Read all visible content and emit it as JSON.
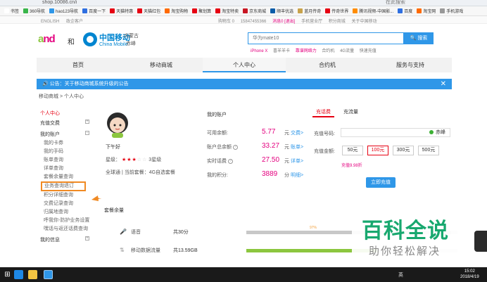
{
  "browser": {
    "url": "shop.10086.cn/i",
    "search_hint": "在此搜索",
    "bookmarks": [
      {
        "label": "书签",
        "color": "#ffffff"
      },
      {
        "label": "360导航",
        "color": "#39b54a"
      },
      {
        "label": "hao123导航",
        "color": "#2f97e8"
      },
      {
        "label": "百度一下",
        "color": "#2f6fe0"
      },
      {
        "label": "天猫特惠",
        "color": "#e60012"
      },
      {
        "label": "天猫红包",
        "color": "#e60012"
      },
      {
        "label": "淘宝购物",
        "color": "#ff6a00"
      },
      {
        "label": "聚划算",
        "color": "#e60012"
      },
      {
        "label": "淘宝特卖",
        "color": "#e60012"
      },
      {
        "label": "京东商城",
        "color": "#c81623"
      },
      {
        "label": "顺丰优选",
        "color": "#0a5ca8"
      },
      {
        "label": "蓝月传奇",
        "color": "#c8a24a"
      },
      {
        "label": "传奇世界",
        "color": "#e60012"
      },
      {
        "label": "腾讯视频-中国影...",
        "color": "#ff8c00"
      },
      {
        "label": "百度",
        "color": "#2f6fe0"
      },
      {
        "label": "淘宝网",
        "color": "#ff6a00"
      },
      {
        "label": "手机游戏",
        "color": "#999999"
      }
    ]
  },
  "topstrip": {
    "left": [
      "ENGLISH",
      "政企客户"
    ],
    "right": [
      "购物车 0",
      "15847455366",
      "消息0 [退出]",
      "手机营业厅",
      "积分商城",
      "关于中国移动"
    ]
  },
  "header": {
    "logo_and": "and",
    "logo_he": "和",
    "brand_cn": "中国移动",
    "brand_en": "China Mobile",
    "region_province": "内蒙古",
    "region_city": "赤峰",
    "search_placeholder": "华为mate10",
    "search_button": "搜索",
    "hotwords": [
      "iPhone X",
      "喜羊羊卡",
      "靠谱网络力",
      "合约机",
      "4G流量",
      "快速充值"
    ]
  },
  "nav": {
    "items": [
      "首页",
      "移动商城",
      "个人中心",
      "合约机",
      "服务与支持"
    ],
    "active_index": 2
  },
  "notice": {
    "text": "公告：关于移动商城系统升级的公告",
    "close": "✕"
  },
  "breadcrumb": "移动商城 > 个人中心",
  "sidebar": {
    "head": "个人中心",
    "sections": [
      {
        "title": "充值交费",
        "items": []
      },
      {
        "title": "我的账户",
        "items": [
          "我的卡券",
          "我的手码",
          "账单查询",
          "详单查询",
          "套餐余量查询",
          "业务查询退订",
          "积分详细查询",
          "交费记录查询",
          "归属地查询",
          "呼我你-防护业务设置",
          "嘿话与返还话费查询"
        ]
      },
      {
        "title": "我的信息",
        "items": []
      }
    ],
    "highlighted_item": "业务查询退订"
  },
  "profile": {
    "greeting": "下午好",
    "stars_label": "星级：",
    "stars": 3,
    "stars_max": 5,
    "star_level": "3星级",
    "plan": "全球通 | 当前套餐：4G自选套餐"
  },
  "account": {
    "title": "我的账户",
    "rows": [
      {
        "label": "可用余额:",
        "value": "5.77",
        "unit": "元",
        "link": "交费>"
      },
      {
        "label": "账户总余额",
        "value": "33.27",
        "unit": "元",
        "link": "账单>"
      },
      {
        "label": "实时话费",
        "value": "27.50",
        "unit": "元",
        "link": "详单>"
      },
      {
        "label": "我的积分:",
        "value": "3889",
        "unit": "分",
        "link": "明细>"
      }
    ]
  },
  "recharge": {
    "tabs": [
      "充话费",
      "充流量"
    ],
    "active_tab": 0,
    "phone_label": "充值号码:",
    "phone_city": "赤峰",
    "amount_label": "充值金额:",
    "amounts": [
      "50元",
      "100元",
      "300元",
      "500元"
    ],
    "selected_amount": 1,
    "price_text": "充值9.98折",
    "button": "立即充值"
  },
  "balance": {
    "title": "套餐余量",
    "rows": [
      {
        "icon": "phone-icon",
        "name": "语音",
        "total": "共30分",
        "used_fraction": 0.97,
        "color": "#c8c8c8",
        "pct_label": "97%"
      },
      {
        "icon": "data-icon",
        "name": "移动数据流量",
        "total": "共13.59GB",
        "used_fraction": 0.62,
        "color": "#8cc63f"
      }
    ]
  },
  "watermark": {
    "title": "百科全说",
    "subtitle": "助你轻松解决"
  },
  "taskbar": {
    "tray": "英",
    "time": "15:02",
    "date": "2018/4/19"
  }
}
